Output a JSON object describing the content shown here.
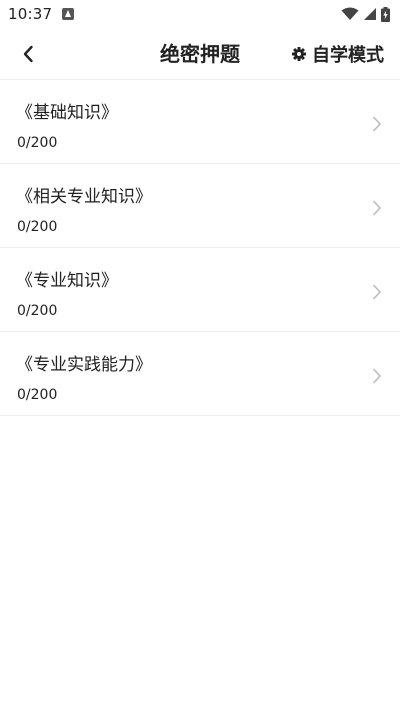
{
  "status_bar": {
    "time": "10:37",
    "icons": [
      "app-notification-icon",
      "wifi-icon",
      "signal-icon",
      "battery-charging-icon"
    ]
  },
  "header": {
    "title": "绝密押题",
    "back_icon": "chevron-left-icon",
    "self_study": {
      "icon": "gear-icon",
      "label": "自学模式"
    }
  },
  "list": {
    "items": [
      {
        "title": "《基础知识》",
        "progress": "0/200"
      },
      {
        "title": "《相关专业知识》",
        "progress": "0/200"
      },
      {
        "title": "《专业知识》",
        "progress": "0/200"
      },
      {
        "title": "《专业实践能力》",
        "progress": "0/200"
      }
    ]
  },
  "colors": {
    "text": "#222222",
    "divider": "#eeeeee",
    "chevron": "#bbbbbb"
  }
}
